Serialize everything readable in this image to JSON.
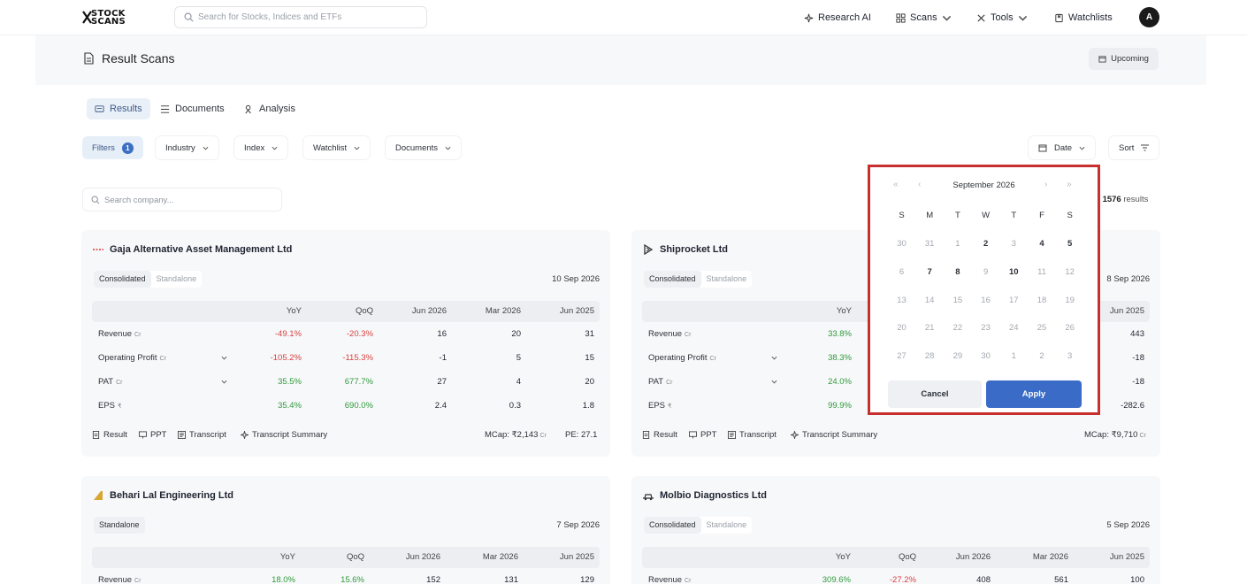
{
  "nav": {
    "logo_line1": "STOCK",
    "logo_line2": "SCANS",
    "search_placeholder": "Search for Stocks, Indices and ETFs",
    "research_ai": "Research AI",
    "scans": "Scans",
    "tools": "Tools",
    "watchlists": "Watchlists",
    "avatar_initial": "A"
  },
  "header": {
    "title": "Result Scans",
    "upcoming_label": "Upcoming"
  },
  "tabs": [
    {
      "label": "Results",
      "active": true
    },
    {
      "label": "Documents",
      "active": false
    },
    {
      "label": "Analysis",
      "active": false
    }
  ],
  "filters": {
    "filters_label": "Filters",
    "filters_count": "1",
    "industry": "Industry",
    "index": "Index",
    "watchlist": "Watchlist",
    "documents": "Documents",
    "date": "Date",
    "sort": "Sort"
  },
  "company_search_placeholder": "Search company...",
  "result_count": {
    "prefix": "of",
    "total": "1576",
    "suffix": "results"
  },
  "table_headers": [
    "YoY",
    "QoQ",
    "Jun 2026",
    "Mar 2026",
    "Jun 2025"
  ],
  "footer_links": [
    "Result",
    "PPT",
    "Transcript",
    "Transcript Summary"
  ],
  "cards": [
    {
      "name": "Gaja Alternative Asset Management Ltd",
      "toggle": [
        "Consolidated",
        "Standalone"
      ],
      "date": "10 Sep 2026",
      "rows": [
        {
          "label": "Revenue",
          "unit": "Cr",
          "yoy": "-49.1%",
          "qoq": "-20.3%",
          "q1": "16",
          "q2": "20",
          "q3": "31"
        },
        {
          "label": "Operating Profit",
          "unit": "Cr",
          "yoy": "-105.2%",
          "qoq": "-115.3%",
          "q1": "-1",
          "q2": "5",
          "q3": "15"
        },
        {
          "label": "PAT",
          "unit": "Cr",
          "yoy": "35.5%",
          "qoq": "677.7%",
          "q1": "27",
          "q2": "4",
          "q3": "20"
        },
        {
          "label": "EPS",
          "unit": "₹",
          "yoy": "35.4%",
          "qoq": "690.0%",
          "q1": "2.4",
          "q2": "0.3",
          "q3": "1.8"
        }
      ],
      "mcap_label": "MCap:",
      "mcap_value": "₹2,143",
      "mcap_unit": "Cr",
      "pe_label": "PE:",
      "pe_value": "27.1"
    },
    {
      "name": "Shiprocket Ltd",
      "toggle": [
        "Consolidated",
        "Standalone"
      ],
      "date": "8 Sep 2026",
      "rows": [
        {
          "label": "Revenue",
          "unit": "Cr",
          "yoy": "33.8%",
          "q3": "443"
        },
        {
          "label": "Operating Profit",
          "unit": "Cr",
          "yoy": "38.3%",
          "q3": "-18"
        },
        {
          "label": "PAT",
          "unit": "Cr",
          "yoy": "24.0%",
          "q3": "-18"
        },
        {
          "label": "EPS",
          "unit": "₹",
          "yoy": "99.9%",
          "q3": "-282.6"
        }
      ],
      "mcap_label": "MCap:",
      "mcap_value": "₹9,710",
      "mcap_unit": "Cr"
    },
    {
      "name": "Behari Lal Engineering Ltd",
      "toggle": [
        "Standalone"
      ],
      "date": "7 Sep 2026",
      "rows": [
        {
          "label": "Revenue",
          "unit": "Cr",
          "yoy": "18.0%",
          "qoq": "15.6%",
          "q1": "152",
          "q2": "131",
          "q3": "129"
        }
      ]
    },
    {
      "name": "Molbio Diagnostics Ltd",
      "toggle": [
        "Consolidated",
        "Standalone"
      ],
      "date": "5 Sep 2026",
      "rows": [
        {
          "label": "Revenue",
          "unit": "Cr",
          "yoy": "309.6%",
          "qoq": "-27.2%",
          "q1": "408",
          "q2": "561",
          "q3": "100"
        }
      ]
    }
  ],
  "calendar": {
    "month": "September 2026",
    "weekdays": [
      "S",
      "M",
      "T",
      "W",
      "T",
      "F",
      "S"
    ],
    "weeks": [
      [
        "30",
        "31",
        "1",
        "2",
        "3",
        "4",
        "5"
      ],
      [
        "6",
        "7",
        "8",
        "9",
        "10",
        "11",
        "12"
      ],
      [
        "13",
        "14",
        "15",
        "16",
        "17",
        "18",
        "19"
      ],
      [
        "20",
        "21",
        "22",
        "23",
        "24",
        "25",
        "26"
      ],
      [
        "27",
        "28",
        "29",
        "30",
        "1",
        "2",
        "3"
      ]
    ],
    "bold_days": [
      "2",
      "4",
      "5",
      "7",
      "8",
      "10"
    ],
    "cancel_label": "Cancel",
    "apply_label": "Apply"
  },
  "colors": {
    "accent": "#3a6bc7",
    "negative": "#d94040",
    "positive": "#2f9a3a",
    "highlight_border": "#c82f2f"
  }
}
